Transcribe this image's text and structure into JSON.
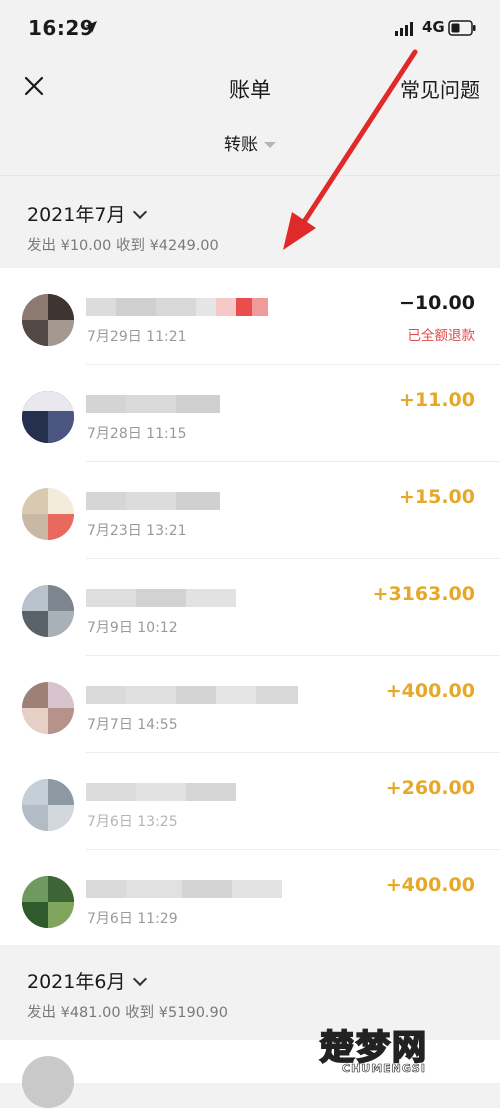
{
  "status": {
    "time": "16:29",
    "network": "4G"
  },
  "nav": {
    "title": "账单",
    "faq_label": "常见问题"
  },
  "filter": {
    "label": "转账"
  },
  "months": [
    {
      "label": "2021年7月",
      "summary": "发出 ¥10.00 收到 ¥4249.00",
      "items": [
        {
          "date": "7月29日 11:21",
          "amount": "−10.00",
          "note": "已全额退款",
          "kind": "neg"
        },
        {
          "date": "7月28日 11:15",
          "amount": "+11.00",
          "note": "",
          "kind": "pos"
        },
        {
          "date": "7月23日 13:21",
          "amount": "+15.00",
          "note": "",
          "kind": "pos"
        },
        {
          "date": "7月9日 10:12",
          "amount": "+3163.00",
          "note": "",
          "kind": "pos"
        },
        {
          "date": "7月7日 14:55",
          "amount": "+400.00",
          "note": "",
          "kind": "pos"
        },
        {
          "date": "7月6日 13:25",
          "amount": "+260.00",
          "note": "",
          "kind": "pos"
        },
        {
          "date": "7月6日 11:29",
          "amount": "+400.00",
          "note": "",
          "kind": "pos"
        }
      ]
    },
    {
      "label": "2021年6月",
      "summary": "发出 ¥481.00 收到 ¥5190.90",
      "items": []
    }
  ],
  "watermark": {
    "cn": "楚梦网",
    "en": "CHUMENGSI"
  },
  "colors": {
    "positive": "#e6a826",
    "refund": "#e14b4b",
    "arrow": "#e02a2a"
  }
}
